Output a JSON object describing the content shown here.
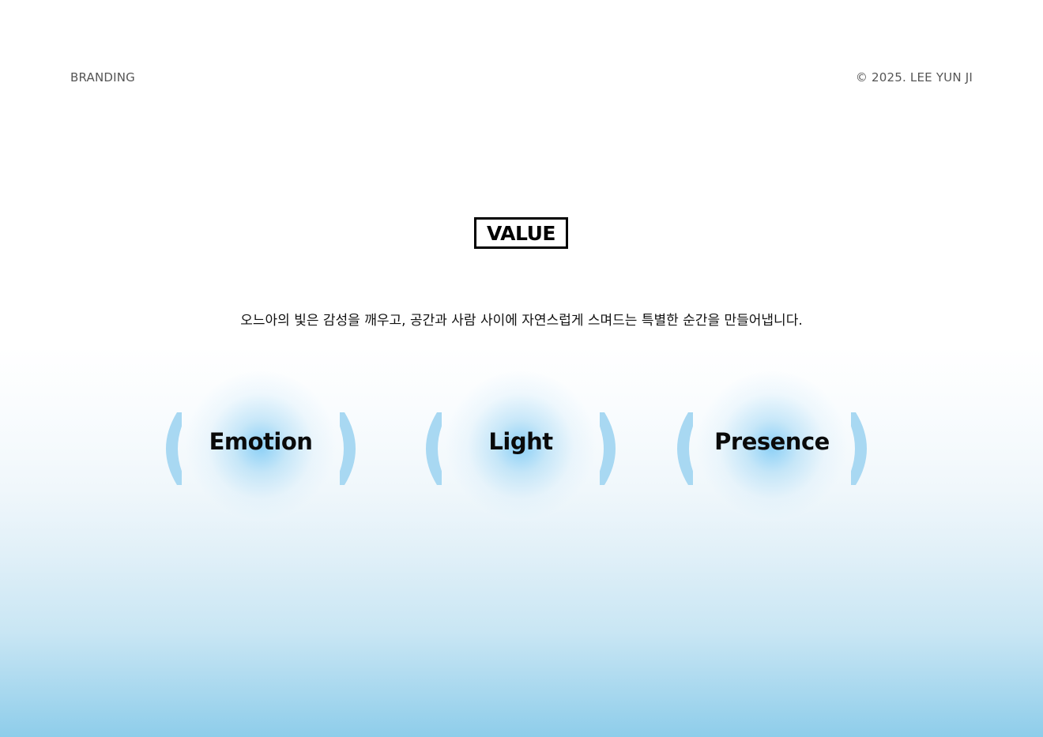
{
  "header": {
    "left_label": "BRANDING",
    "right_label": "© 2025. LEE YUN JI"
  },
  "section": {
    "title": "VALUE",
    "description": "오느아의 빛은 감성을 깨우고, 공간과 사람 사이에 자연스럽게 스며드는 특별한 순간을 만들어냅니다."
  },
  "values": [
    {
      "label": "Emotion"
    },
    {
      "label": "Light"
    },
    {
      "label": "Presence"
    }
  ],
  "colors": {
    "accent_blue": "#a8d8f2",
    "text": "#000000",
    "muted_text": "#555555"
  }
}
